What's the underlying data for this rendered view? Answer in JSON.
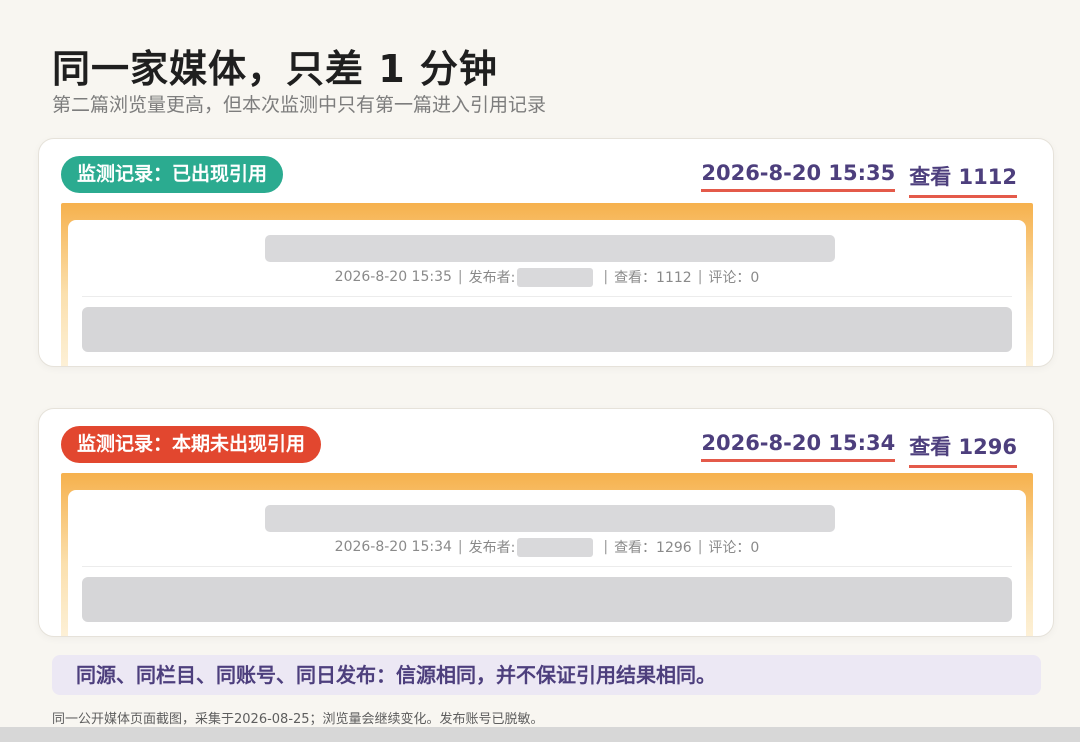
{
  "header": {
    "title": "同一家媒体，只差 1 分钟",
    "subtitle": "第二篇浏览量更高，但本次监测中只有第一篇进入引用记录"
  },
  "cards": [
    {
      "badge": "监测记录：已出现引用",
      "badge_color": "#2bab90",
      "datetime": "2026-8-20 15:35",
      "views": "查看 1112",
      "shot": {
        "date": "2026-8-20 15:35",
        "sep": "|",
        "publisher_label": "发布者:",
        "views": "查看：1112",
        "comments": "评论：0"
      }
    },
    {
      "badge": "监测记录：本期未出现引用",
      "badge_color": "#e2472f",
      "datetime": "2026-8-20 15:34",
      "views": "查看 1296",
      "shot": {
        "date": "2026-8-20 15:34",
        "sep": "|",
        "publisher_label": "发布者:",
        "views": "查看：1296",
        "comments": "评论：0"
      }
    }
  ],
  "note": "同源、同栏目、同账号、同日发布：信源相同，并不保证引用结果相同。",
  "footnote": "同一公开媒体页面截图，采集于2026-08-25；浏览量会继续变化。发布账号已脱敏。",
  "colors": {
    "accent_purple": "#4d3f7d",
    "underline_red": "#e45a4a",
    "badge_green": "#2bab90",
    "badge_red": "#e2472f"
  }
}
